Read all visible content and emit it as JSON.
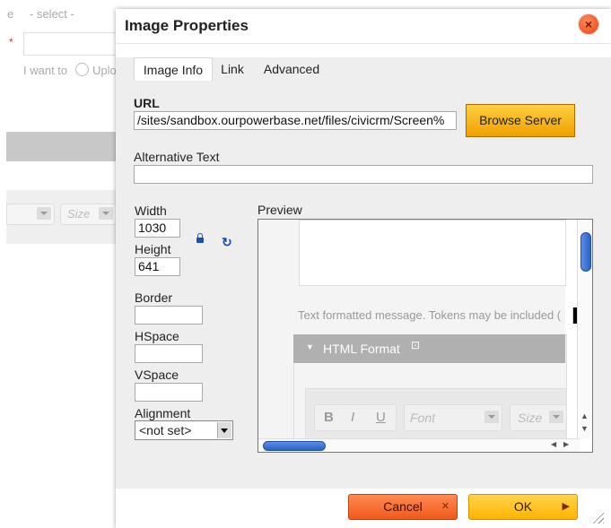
{
  "background": {
    "cut_label": "e",
    "select_placeholder": "- select -",
    "required_mark": "*",
    "radio_text": "I want to",
    "radio_text_tail": "Uplo",
    "size_placeholder": "Size"
  },
  "dialog": {
    "title": "Image Properties",
    "close_icon": "×",
    "tabs": [
      {
        "label": "Image Info",
        "active": true
      },
      {
        "label": "Link",
        "active": false
      },
      {
        "label": "Advanced",
        "active": false
      }
    ],
    "url": {
      "label": "URL",
      "value": "/sites/sandbox.ourpowerbase.net/files/civicrm/Screen%"
    },
    "browse_label": "Browse Server",
    "alt_text": {
      "label": "Alternative Text",
      "value": ""
    },
    "width": {
      "label": "Width",
      "value": "1030"
    },
    "height": {
      "label": "Height",
      "value": "641"
    },
    "lock_icon": "lock-icon",
    "reset_icon": "↻",
    "border": {
      "label": "Border",
      "value": ""
    },
    "hspace": {
      "label": "HSpace",
      "value": ""
    },
    "vspace": {
      "label": "VSpace",
      "value": ""
    },
    "alignment": {
      "label": "Alignment",
      "value": "<not set>"
    },
    "preview": {
      "label": "Preview",
      "hint_text": "Text formatted message. Tokens may be included (",
      "section_title": "HTML Format",
      "font_placeholder": "Font",
      "size_placeholder": "Size",
      "bold": "B",
      "italic": "I",
      "underline": "U"
    },
    "cancel_label": "Cancel",
    "ok_label": "OK",
    "colors": {
      "cancel": "#f05a1a",
      "ok": "#ffb300",
      "browse": "#f0a000",
      "close": "#e8430f"
    }
  }
}
